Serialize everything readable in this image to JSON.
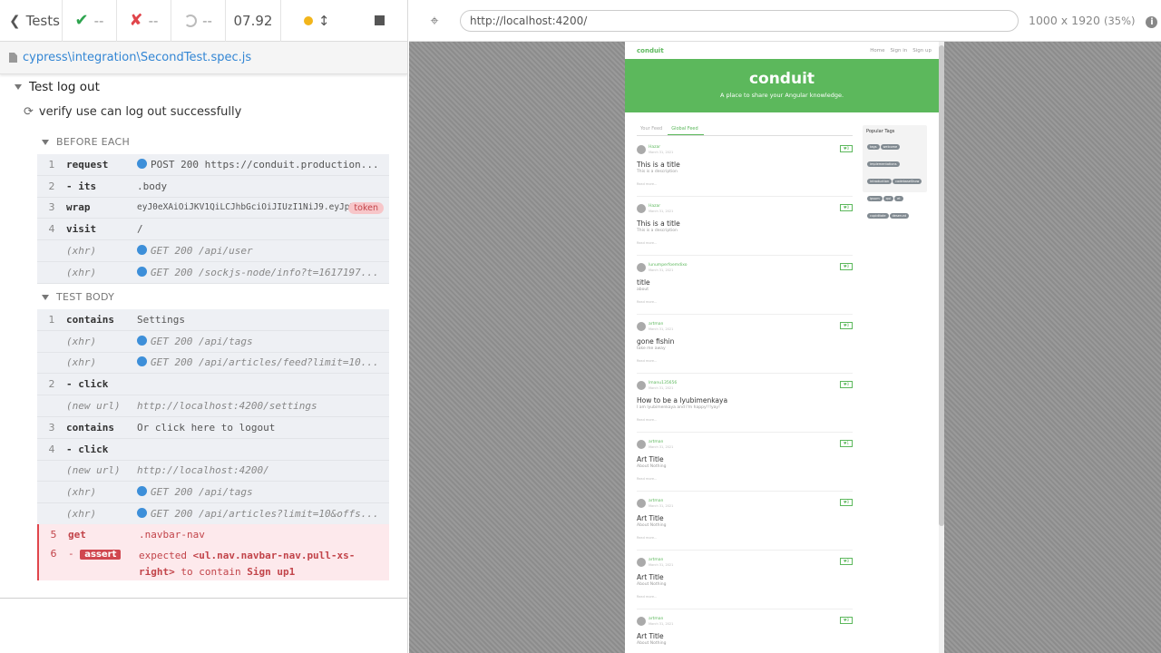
{
  "stats": {
    "tests_label": "Tests",
    "passed": "--",
    "failed": "--",
    "pending": "--",
    "duration": "07.92"
  },
  "spec": {
    "path": "cypress\\integration\\SecondTest.spec.js"
  },
  "suite": {
    "title": "Test log out",
    "test_title": "verify use can log out successfully"
  },
  "before_each": {
    "header": "BEFORE EACH",
    "commands": [
      {
        "num": "1",
        "name": "request",
        "msg": "POST 200 https://conduit.production..."
      },
      {
        "num": "2",
        "name": "- its",
        "msg": ".body"
      },
      {
        "num": "3",
        "name": "wrap",
        "msg": "eyJ0eXAiOiJKV1QiLCJhbGciOiJIUzI1NiJ9.eyJpZCI6...",
        "badge": "token"
      },
      {
        "num": "4",
        "name": "visit",
        "msg": "/"
      },
      {
        "num": "",
        "name": "(xhr)",
        "msg": "GET 200 /api/user"
      },
      {
        "num": "",
        "name": "(xhr)",
        "msg": "GET 200 /sockjs-node/info?t=1617197..."
      }
    ]
  },
  "test_body": {
    "header": "TEST BODY",
    "commands": [
      {
        "num": "1",
        "name": "contains",
        "msg": "Settings"
      },
      {
        "num": "",
        "name": "(xhr)",
        "msg": "GET 200 /api/tags"
      },
      {
        "num": "",
        "name": "(xhr)",
        "msg": "GET 200 /api/articles/feed?limit=10..."
      },
      {
        "num": "2",
        "name": "- click",
        "msg": ""
      },
      {
        "num": "",
        "name": "(new url)",
        "msg": "http://localhost:4200/settings"
      },
      {
        "num": "3",
        "name": "contains",
        "msg": "Or click here to logout"
      },
      {
        "num": "4",
        "name": "- click",
        "msg": ""
      },
      {
        "num": "",
        "name": "(new url)",
        "msg": "http://localhost:4200/"
      },
      {
        "num": "",
        "name": "(xhr)",
        "msg": "GET 200 /api/tags"
      },
      {
        "num": "",
        "name": "(xhr)",
        "msg": "GET 200 /api/articles?limit=10&offs..."
      }
    ],
    "failed": {
      "get_num": "5",
      "get_name": "get",
      "get_msg": ".navbar-nav",
      "assert_num": "6",
      "assert_dash": "-",
      "assert_label": "assert",
      "err_prefix": "expected",
      "err_selector": "<ul.nav.navbar-nav.pull-xs-right>",
      "err_middle": "to contain",
      "err_value": "Sign up1"
    }
  },
  "aut": {
    "url": "http://localhost:4200/",
    "viewport": "1000 x 1920",
    "scale": "(35%)"
  },
  "conduit": {
    "brand": "conduit",
    "nav": [
      "Home",
      "Sign in",
      "Sign up"
    ],
    "banner_title": "conduit",
    "banner_sub": "A place to share your Angular knowledge.",
    "tabs": [
      "Your Feed",
      "Global Feed"
    ],
    "sidebar_title": "Popular Tags",
    "tags": [
      "tags",
      "welcome",
      "implementations",
      "introduction",
      "codebaseShow",
      "ipsum",
      "qui",
      "et",
      "cupiditate",
      "deserunt"
    ],
    "articles": [
      {
        "author": "Hazar",
        "date": "March 31, 2021",
        "likes": "0",
        "title": "This is a title",
        "desc": "This is a description"
      },
      {
        "author": "Hazar",
        "date": "March 31, 2021",
        "likes": "0",
        "title": "This is a title",
        "desc": "This is a description"
      },
      {
        "author": "lunumperfoemdixo",
        "date": "March 31, 2021",
        "likes": "0",
        "title": "title",
        "desc": "about"
      },
      {
        "author": "artman",
        "date": "March 31, 2021",
        "likes": "0",
        "title": "gone fishin",
        "desc": "take me away"
      },
      {
        "author": "lmanu135656",
        "date": "March 31, 2021",
        "likes": "0",
        "title": "How to be a lyubimenkaya",
        "desc": "I am lyubimenkaya and I'm happy!!!yay!"
      },
      {
        "author": "artman",
        "date": "March 31, 2021",
        "likes": "1",
        "title": "Art Title",
        "desc": "About Nothing"
      },
      {
        "author": "artman",
        "date": "March 31, 2021",
        "likes": "0",
        "title": "Art Title",
        "desc": "About Nothing"
      },
      {
        "author": "artman",
        "date": "March 31, 2021",
        "likes": "0",
        "title": "Art Title",
        "desc": "About Nothing"
      },
      {
        "author": "artman",
        "date": "March 31, 2021",
        "likes": "0",
        "title": "Art Title",
        "desc": "About Nothing"
      }
    ],
    "read_more": "Read more..."
  }
}
